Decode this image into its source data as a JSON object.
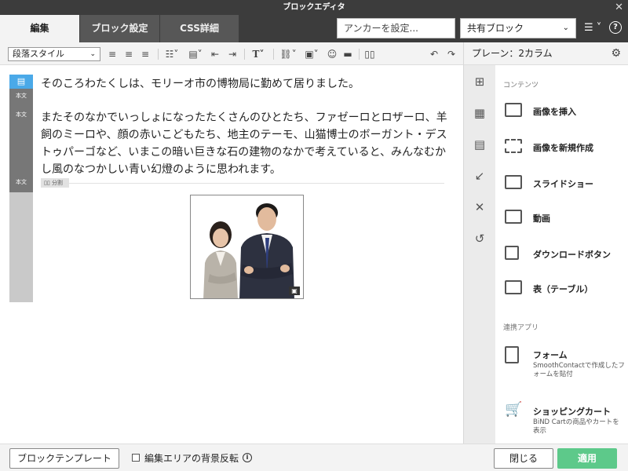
{
  "window": {
    "title": "ブロックエディタ"
  },
  "tabs": [
    {
      "label": "編集"
    },
    {
      "label": "ブロック設定"
    },
    {
      "label": "CSS詳細"
    }
  ],
  "header": {
    "anchor_placeholder": "アンカーを設定...",
    "shared_block": "共有ブロック"
  },
  "toolbar": {
    "paragraph_style": "段落スタイル"
  },
  "editor": {
    "gutter_labels": [
      "本文",
      "本文",
      "本文"
    ],
    "paragraph1": "そのころわたくしは、モリーオ市の博物局に勤めて居りました。",
    "paragraph2": "またそのなかでいっしょになったたくさんのひとたち、ファゼーロとロザーロ、羊飼のミーロや、顔の赤いこどもたち、地主のテーモ、山猫博士のボーガント・デストゥパーゴなど、いまこの暗い巨きな石の建物のなかで考えていると、みんなむかし風のなつかしい青い幻燈のように思われます。",
    "divider_label": "分割"
  },
  "pane": {
    "title": "プレーン：2カラム",
    "section_contents": "コンテンツ",
    "section_apps": "連携アプリ",
    "items": [
      {
        "label": "画像を挿入"
      },
      {
        "label": "画像を新規作成"
      },
      {
        "label": "スライドショー"
      },
      {
        "label": "動画"
      },
      {
        "label": "ダウンロードボタン"
      },
      {
        "label": "表（テーブル）"
      }
    ],
    "apps": [
      {
        "label": "フォーム",
        "desc": "SmoothContactで作成したフォームを貼付"
      },
      {
        "label": "ショッピングカート",
        "desc": "BiND Cartの商品やカートを表示"
      }
    ]
  },
  "footer": {
    "template_button": "ブロックテンプレート",
    "invert_label": "編集エリアの背景反転",
    "close_button": "閉じる",
    "apply_button": "適用"
  },
  "colors": {
    "accent": "#5dc98a",
    "gutter_active": "#4aa9e8",
    "dark_bar": "#3c3c3c"
  }
}
